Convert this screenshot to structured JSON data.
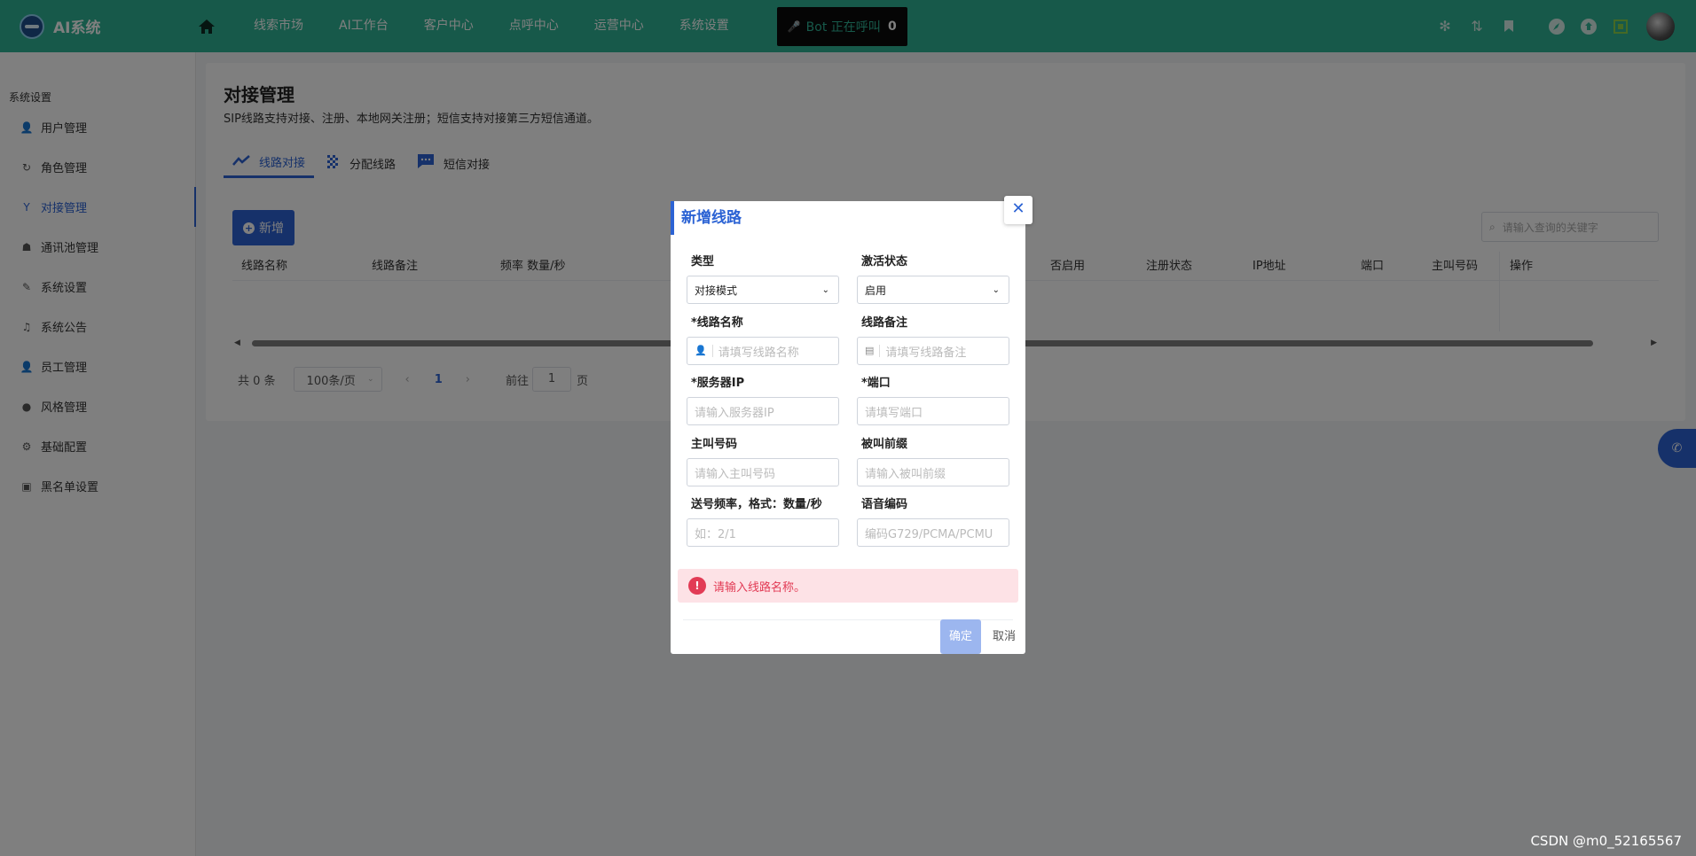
{
  "header": {
    "app_name": "AI系统",
    "nav": [
      "线索市场",
      "AI工作台",
      "客户中心",
      "点呼中心",
      "运营中心",
      "系统设置"
    ],
    "bot_status": "Bot 正在呼叫",
    "bot_count": "0",
    "icons": [
      "aperture-icon",
      "transfer-icon",
      "bookmark-icon",
      "compass-icon",
      "shield-icon",
      "fullscreen-icon"
    ],
    "accent": "#2eb394"
  },
  "sidebar": {
    "title": "系统设置",
    "items": [
      {
        "label": "用户管理",
        "icon": "user-gear-icon"
      },
      {
        "label": "角色管理",
        "icon": "role-icon"
      },
      {
        "label": "对接管理",
        "icon": "merge-icon",
        "active": true
      },
      {
        "label": "通讯池管理",
        "icon": "pool-icon"
      },
      {
        "label": "系统设置",
        "icon": "pen-icon"
      },
      {
        "label": "系统公告",
        "icon": "bell-icon"
      },
      {
        "label": "员工管理",
        "icon": "staff-icon"
      },
      {
        "label": "风格管理",
        "icon": "palette-icon"
      },
      {
        "label": "基础配置",
        "icon": "gear-icon"
      },
      {
        "label": "黑名单设置",
        "icon": "blacklist-icon"
      }
    ]
  },
  "main": {
    "title": "对接管理",
    "description": "SIP线路支持对接、注册、本地网关注册；短信支持对接第三方短信通道。",
    "tabs": [
      {
        "label": "线路对接",
        "active": true
      },
      {
        "label": "分配线路"
      },
      {
        "label": "短信对接"
      }
    ],
    "add_label": "新增",
    "search_placeholder": "请输入查询的关键字",
    "columns": [
      "线路名称",
      "线路备注",
      "频率 数量/秒",
      "否启用",
      "注册状态",
      "IP地址",
      "端口",
      "主叫号码",
      "操作"
    ],
    "pager": {
      "total": "共 0 条",
      "page_size": "100条/页",
      "current": "1",
      "goto_label": "前往",
      "goto_value": "1",
      "page_suffix": "页"
    }
  },
  "modal": {
    "title": "新增线路",
    "fields": {
      "type_label": "类型",
      "type_value": "对接模式",
      "status_label": "激活状态",
      "status_value": "启用",
      "name_label": "*线路名称",
      "name_placeholder": "请填写线路名称",
      "remark_label": "线路备注",
      "remark_placeholder": "请填写线路备注",
      "ip_label": "*服务器IP",
      "ip_placeholder": "请输入服务器IP",
      "port_label": "*端口",
      "port_placeholder": "请填写端口",
      "caller_label": "主叫号码",
      "caller_placeholder": "请输入主叫号码",
      "prefix_label": "被叫前缀",
      "prefix_placeholder": "请输入被叫前缀",
      "rate_label": "送号频率，格式：数量/秒",
      "rate_placeholder": "如：2/1",
      "codec_label": "语音编码",
      "codec_placeholder": "编码G729/PCMA/PCMU"
    },
    "error": "请输入线路名称。",
    "ok_label": "确定",
    "cancel_label": "取消"
  },
  "watermark": "CSDN @m0_52165567"
}
